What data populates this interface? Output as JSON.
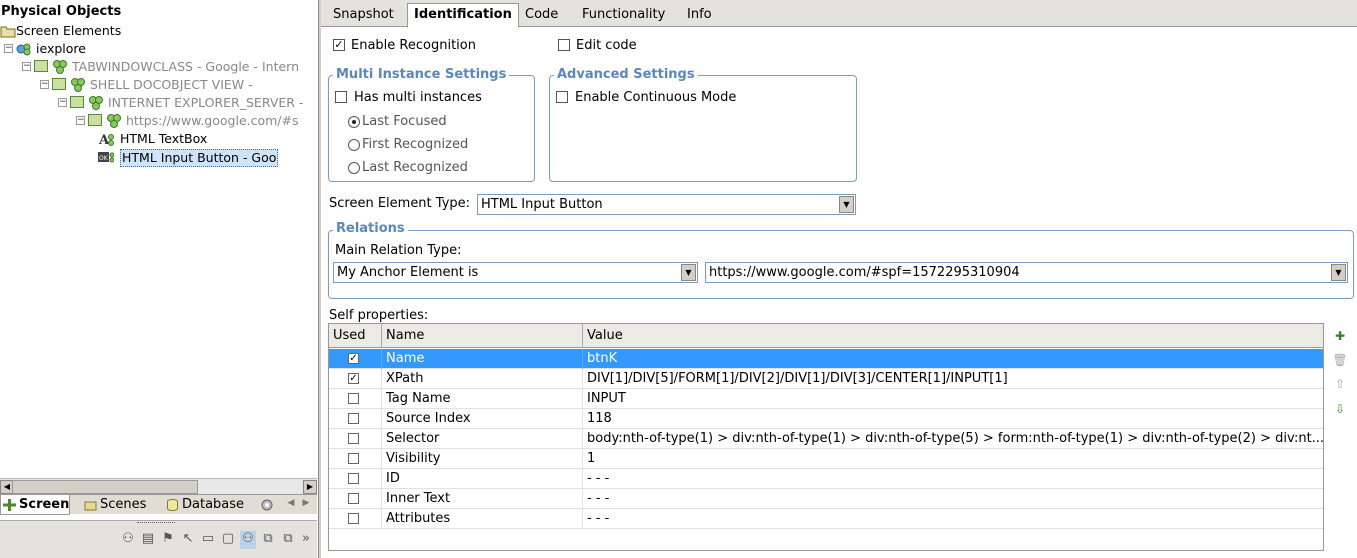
{
  "left_panel": {
    "title": "Physical Objects",
    "tree": [
      {
        "label": "Screen Elements",
        "level": 0,
        "expander": "",
        "icon": "folder-icon"
      },
      {
        "label": "iexplore",
        "level": 1,
        "expander": "−",
        "icon": "process-icon"
      },
      {
        "label": "TABWINDOWCLASS - Google - Intern",
        "level": 2,
        "expander": "−",
        "icon": "window-icon"
      },
      {
        "label": "SHELL DOCOBJECT VIEW -",
        "level": 3,
        "expander": "−",
        "icon": "window-icon"
      },
      {
        "label": "INTERNET EXPLORER_SERVER -",
        "level": 4,
        "expander": "−",
        "icon": "window-icon"
      },
      {
        "label": "https://www.google.com/#s",
        "level": 5,
        "expander": "−",
        "icon": "window-icon"
      },
      {
        "label": "HTML TextBox",
        "level": 6,
        "expander": "",
        "icon": "textbox-icon"
      },
      {
        "label": "HTML Input Button - Goo",
        "level": 6,
        "expander": "",
        "icon": "button-element-icon"
      }
    ],
    "bottom_tabs": [
      {
        "label": "Screen",
        "icon": "screen-icon"
      },
      {
        "label": "Scenes",
        "icon": "scenes-icon"
      },
      {
        "label": "Database",
        "icon": "database-icon"
      }
    ]
  },
  "tabs": [
    "Snapshot",
    "Identification",
    "Code",
    "Functionality",
    "Info"
  ],
  "active_tab": "Identification",
  "identification": {
    "enable_recognition": "Enable Recognition",
    "edit_code": "Edit code",
    "multi_instance": {
      "title": "Multi Instance Settings",
      "has_multi": "Has multi instances",
      "options": [
        "Last Focused",
        "First Recognized",
        "Last Recognized"
      ],
      "selected": "Last Focused"
    },
    "advanced": {
      "title": "Advanced Settings",
      "continuous": "Enable Continuous Mode"
    },
    "element_type_label": "Screen Element Type:",
    "element_type_value": "HTML Input Button",
    "relations": {
      "title": "Relations",
      "main_label": "Main Relation Type:",
      "relation_value": "My Anchor Element is",
      "anchor_value": "https://www.google.com/#spf=1572295310904"
    },
    "self_properties": {
      "label": "Self properties:",
      "columns": [
        "Used",
        "Name",
        "Value"
      ],
      "rows": [
        {
          "used": true,
          "name": "Name",
          "value": "btnK"
        },
        {
          "used": true,
          "name": "XPath",
          "value": "DIV[1]/DIV[5]/FORM[1]/DIV[2]/DIV[1]/DIV[3]/CENTER[1]/INPUT[1]"
        },
        {
          "used": false,
          "name": "Tag Name",
          "value": "INPUT"
        },
        {
          "used": false,
          "name": "Source Index",
          "value": "118"
        },
        {
          "used": false,
          "name": "Selector",
          "value": "body:nth-of-type(1) > div:nth-of-type(1) > div:nth-of-type(5) > form:nth-of-type(1) > div:nth-of-type(2) > div:nt..."
        },
        {
          "used": false,
          "name": "Visibility",
          "value": "1"
        },
        {
          "used": false,
          "name": "ID",
          "value": "- - -"
        },
        {
          "used": false,
          "name": "Inner Text",
          "value": "- - -"
        },
        {
          "used": false,
          "name": "Attributes",
          "value": "- - -"
        }
      ],
      "selected_row": "Name"
    }
  },
  "glyphs": {
    "check": "✓",
    "dropdown": "▼",
    "left": "◀",
    "right": "▶"
  },
  "colors": {
    "selection": "#3399ff",
    "group_title": "#5b87c0",
    "group_border": "#7a9cc6"
  }
}
